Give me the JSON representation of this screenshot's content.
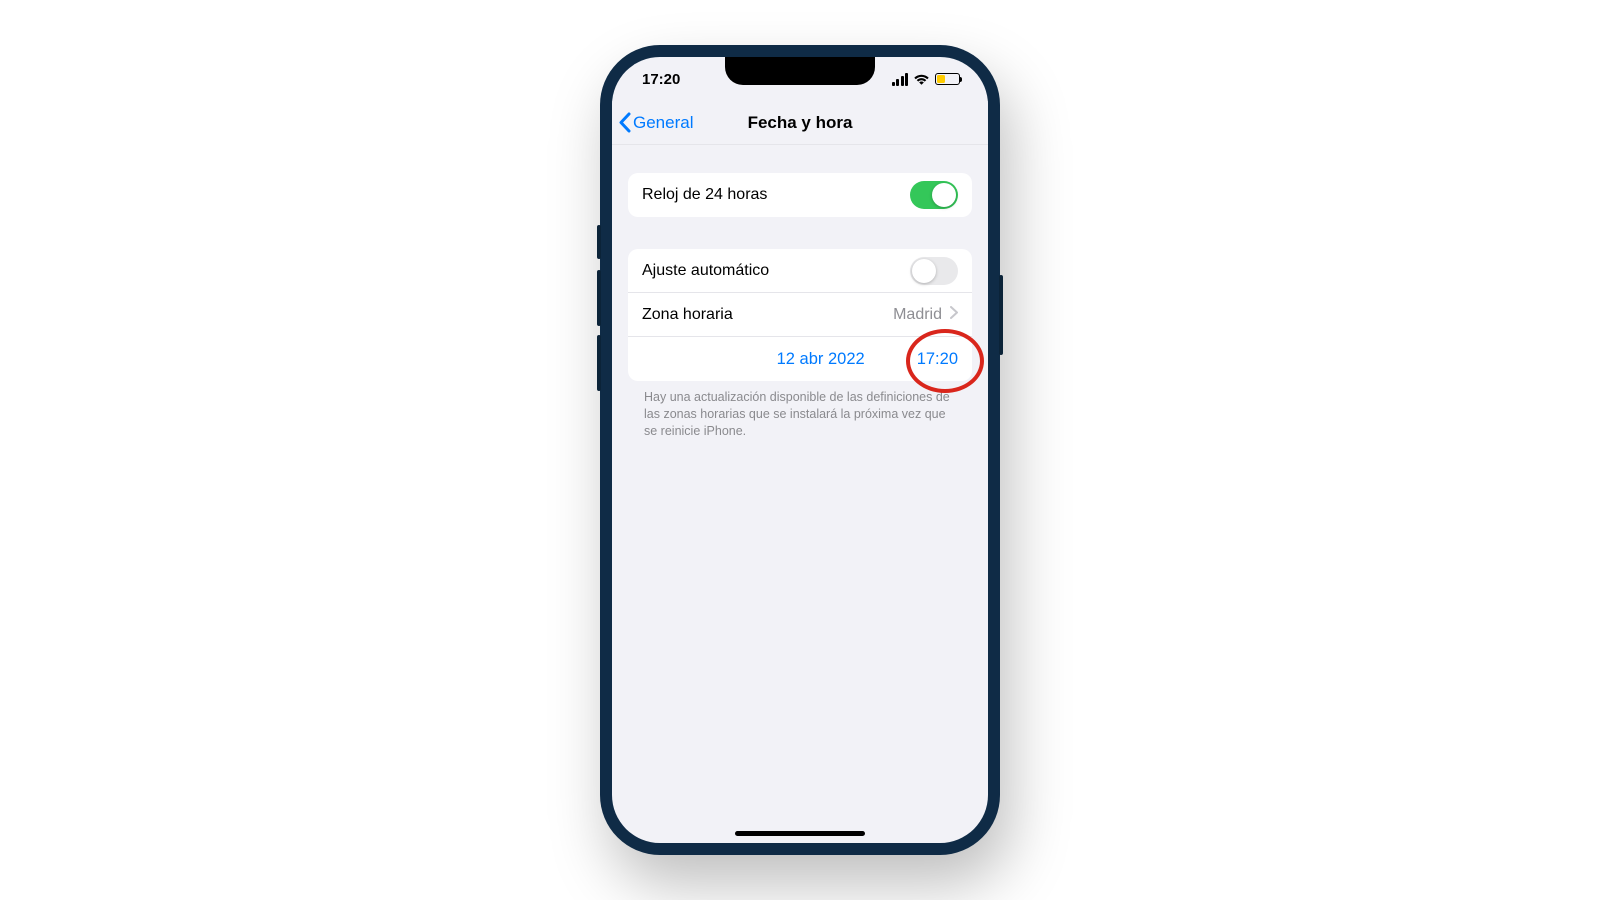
{
  "statusbar": {
    "time": "17:20"
  },
  "navbar": {
    "back_label": "General",
    "title": "Fecha y hora"
  },
  "group1": {
    "row_24h": {
      "label": "Reloj de 24 horas",
      "toggle_on": true
    }
  },
  "group2": {
    "row_auto": {
      "label": "Ajuste automático",
      "toggle_on": false
    },
    "row_tz": {
      "label": "Zona horaria",
      "value": "Madrid"
    },
    "row_dt": {
      "date": "12 abr 2022",
      "time": "17:20"
    }
  },
  "footer": "Hay una actualización disponible de las definiciones de las zonas horarias que se instalará la próxima vez que se reinicie iPhone."
}
